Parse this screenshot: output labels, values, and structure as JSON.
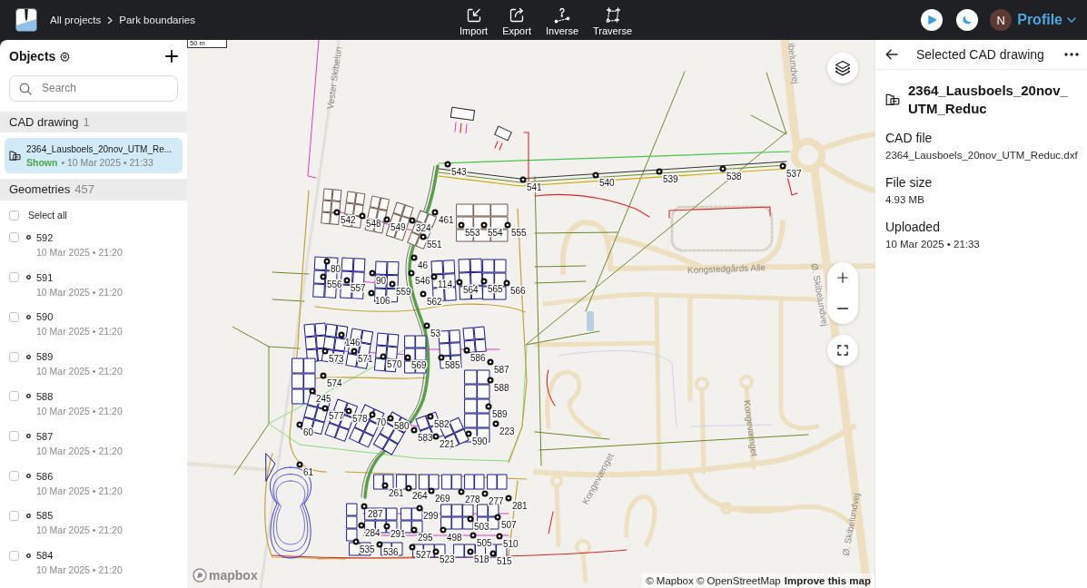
{
  "header": {
    "breadcrumbs": [
      {
        "label": "All projects"
      },
      {
        "label": "Park boundaries"
      }
    ],
    "tools": [
      {
        "kind": "import",
        "label": "Import"
      },
      {
        "kind": "export",
        "label": "Export"
      },
      {
        "kind": "inverse",
        "label": "Inverse"
      },
      {
        "kind": "traverse",
        "label": "Traverse"
      }
    ],
    "user": {
      "initial": "N",
      "label": "Profile"
    }
  },
  "sidebar": {
    "title": "Objects",
    "search": {
      "placeholder": "Search"
    },
    "cad_section": {
      "title": "CAD drawing",
      "count": "1",
      "items": [
        {
          "name": "2364_Lausboels_20nov_UTM_Re...",
          "status": "Shown",
          "meta": "• 10 Mar 2025 • 21:33",
          "selected": true
        }
      ]
    },
    "geometry_section": {
      "title": "Geometries",
      "count": "457",
      "select_all": {
        "label": "Select all",
        "checked": false
      },
      "items": [
        {
          "name": "592",
          "date": "10 Mar 2025 • 21:20",
          "checked": false
        },
        {
          "name": "591",
          "date": "10 Mar 2025 • 21:20",
          "checked": false
        },
        {
          "name": "590",
          "date": "10 Mar 2025 • 21:20",
          "checked": false
        },
        {
          "name": "589",
          "date": "10 Mar 2025 • 21:20",
          "checked": false
        },
        {
          "name": "588",
          "date": "10 Mar 2025 • 21:20",
          "checked": false
        },
        {
          "name": "587",
          "date": "10 Mar 2025 • 21:20",
          "checked": false
        },
        {
          "name": "586",
          "date": "10 Mar 2025 • 21:20",
          "checked": false
        },
        {
          "name": "585",
          "date": "10 Mar 2025 • 21:20",
          "checked": false
        },
        {
          "name": "584",
          "date": "10 Mar 2025 • 21:20",
          "checked": false
        }
      ]
    }
  },
  "map": {
    "scale": "50 m",
    "street_labels": [
      "Vester Skibelun",
      "Kongstedgårds Alle",
      "ibelundvej",
      "Ø. Skibelundvej",
      "Ø. Skibelundvej",
      "Kongevænget",
      "Kongevænget"
    ],
    "point_labels": [
      "543",
      "541",
      "540",
      "539",
      "538",
      "537",
      "542",
      "548",
      "549",
      "324",
      "461",
      "553",
      "554",
      "555",
      "551",
      "46",
      "80",
      "556",
      "557",
      "90",
      "546",
      "114",
      "559",
      "564",
      "565",
      "566",
      "106",
      "562",
      "53",
      "146",
      "573",
      "571",
      "570",
      "569",
      "585",
      "586",
      "587",
      "574",
      "588",
      "245",
      "577",
      "578",
      "70",
      "580",
      "582",
      "589",
      "583",
      "223",
      "221",
      "590",
      "60",
      "61",
      "261",
      "264",
      "269",
      "278",
      "277",
      "281",
      "287",
      "299",
      "503",
      "507",
      "284",
      "291",
      "295",
      "498",
      "505",
      "510",
      "535",
      "536",
      "527",
      "523",
      "518",
      "515"
    ],
    "logo": "mapbox",
    "attribution": "© Mapbox © OpenStreetMap",
    "improve_link": "Improve this map"
  },
  "details": {
    "title": "Selected CAD drawing",
    "name": "2364_Lausboels_20nov_UTM_Reduc",
    "fields": [
      {
        "label": "CAD file",
        "value": "2364_Lausboels_20nov_UTM_Reduc.dxf"
      },
      {
        "label": "File size",
        "value": "4.93 MB"
      },
      {
        "label": "Uploaded",
        "value": "10 Mar 2025 • 21:33"
      }
    ]
  }
}
